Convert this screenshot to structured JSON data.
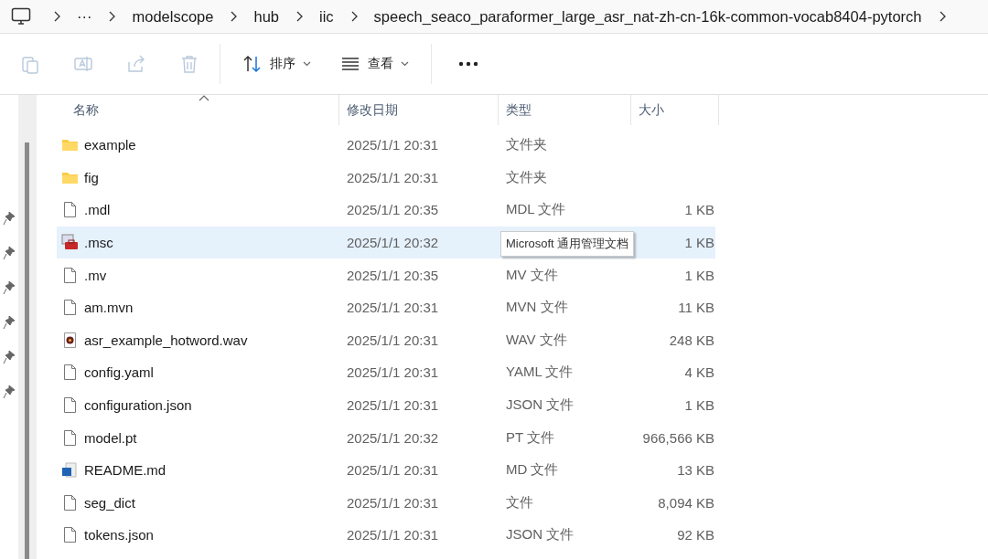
{
  "breadcrumb": {
    "overflow": "···",
    "items": [
      "modelscope",
      "hub",
      "iic",
      "speech_seaco_paraformer_large_asr_nat-zh-cn-16k-common-vocab8404-pytorch"
    ]
  },
  "toolbar": {
    "actions": [
      {
        "kind": "copy",
        "disabled": true
      },
      {
        "kind": "rename",
        "disabled": true
      },
      {
        "kind": "share",
        "disabled": true
      },
      {
        "kind": "delete",
        "disabled": true
      }
    ],
    "sort": {
      "label": "排序"
    },
    "view": {
      "label": "查看"
    }
  },
  "columns": [
    "名称",
    "修改日期",
    "类型",
    "大小"
  ],
  "rows": [
    {
      "kind": "folder",
      "name": "example",
      "date": "2025/1/1 20:31",
      "type": "文件夹",
      "size": "",
      "hovered": false
    },
    {
      "kind": "folder",
      "name": "fig",
      "date": "2025/1/1 20:31",
      "type": "文件夹",
      "size": "",
      "hovered": false
    },
    {
      "kind": "file",
      "name": ".mdl",
      "date": "2025/1/1 20:35",
      "type": "MDL 文件",
      "size": "1 KB",
      "hovered": false
    },
    {
      "kind": "msc",
      "name": ".msc",
      "date": "2025/1/1 20:32",
      "type": "",
      "tooltip": "Microsoft 通用管理文档",
      "size": "1 KB",
      "hovered": true
    },
    {
      "kind": "file",
      "name": ".mv",
      "date": "2025/1/1 20:35",
      "type": "MV 文件",
      "size": "1 KB",
      "hovered": false
    },
    {
      "kind": "file",
      "name": "am.mvn",
      "date": "2025/1/1 20:31",
      "type": "MVN 文件",
      "size": "11 KB",
      "hovered": false
    },
    {
      "kind": "audio",
      "name": "asr_example_hotword.wav",
      "date": "2025/1/1 20:31",
      "type": "WAV 文件",
      "size": "248 KB",
      "hovered": false
    },
    {
      "kind": "file",
      "name": "config.yaml",
      "date": "2025/1/1 20:31",
      "type": "YAML 文件",
      "size": "4 KB",
      "hovered": false
    },
    {
      "kind": "file",
      "name": "configuration.json",
      "date": "2025/1/1 20:31",
      "type": "JSON 文件",
      "size": "1 KB",
      "hovered": false
    },
    {
      "kind": "file",
      "name": "model.pt",
      "date": "2025/1/1 20:32",
      "type": "PT 文件",
      "size": "966,566 KB",
      "hovered": false
    },
    {
      "kind": "doc",
      "name": "README.md",
      "date": "2025/1/1 20:31",
      "type": "MD 文件",
      "size": "13 KB",
      "hovered": false
    },
    {
      "kind": "file",
      "name": "seg_dict",
      "date": "2025/1/1 20:31",
      "type": "文件",
      "size": "8,094 KB",
      "hovered": false
    },
    {
      "kind": "file",
      "name": "tokens.json",
      "date": "2025/1/1 20:31",
      "type": "JSON 文件",
      "size": "92 KB",
      "hovered": false
    }
  ]
}
